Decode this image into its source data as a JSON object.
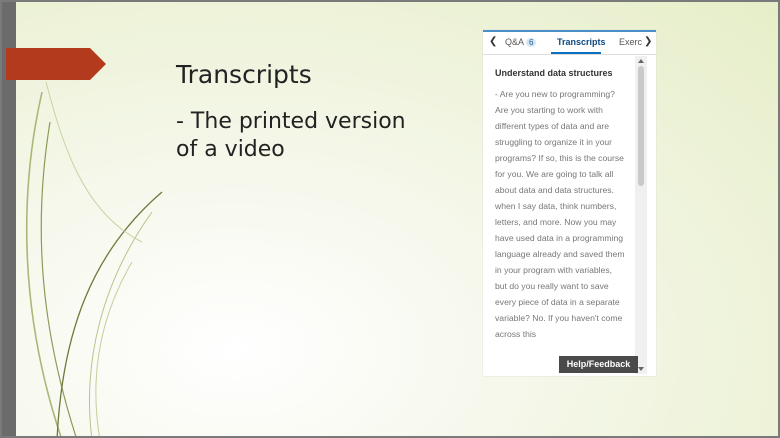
{
  "slide": {
    "title": "Transcripts",
    "bullet": "- The printed version of a video"
  },
  "panel": {
    "tabs": [
      {
        "label": "Q&A",
        "badge": "6"
      },
      {
        "label": "Transcripts"
      },
      {
        "label": "Exerc"
      }
    ],
    "heading": "Understand data structures",
    "transcript": "- Are you new to programming? Are you starting to work with different types of data and are struggling to organize it in your programs? If so, this is the course for you. We are going to talk all about data and data structures. when I say data, think numbers, letters, and more. Now you may have used data in a programming language already and saved them in your program with variables, but do you really want to save every piece of data in a separate variable? No. If you haven't come across this"
  },
  "help": {
    "label": "Help/Feedback"
  },
  "icons": {
    "prev": "chevron-left-icon",
    "next": "chevron-right-icon"
  }
}
